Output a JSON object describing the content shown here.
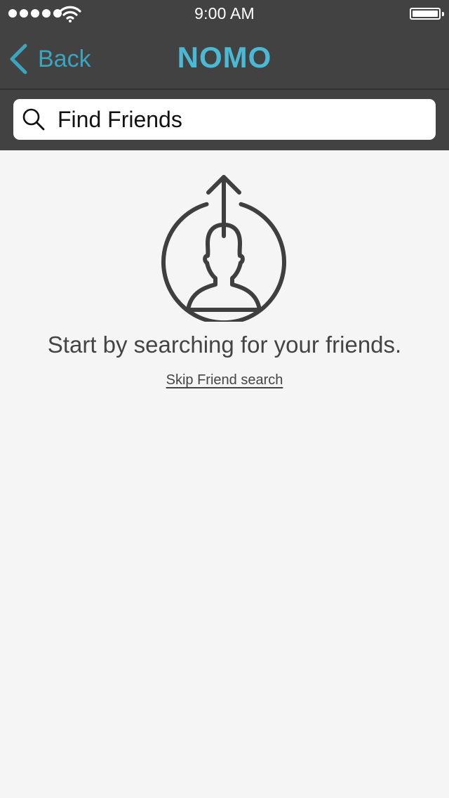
{
  "status_bar": {
    "time": "9:00 AM",
    "signal_bars": 5,
    "battery_level": 1.0
  },
  "nav": {
    "back_label": "Back",
    "title": "NOMO"
  },
  "search": {
    "placeholder": "Find Friends",
    "value": ""
  },
  "empty_state": {
    "icon": "user-upload-icon",
    "message": "Start by searching for your friends.",
    "skip_label": "Skip Friend search"
  },
  "colors": {
    "header_bg": "#424242",
    "accent": "#3aa6bd",
    "brand": "#4bb9d3",
    "content_bg": "#f5f5f5",
    "text": "#444444"
  }
}
